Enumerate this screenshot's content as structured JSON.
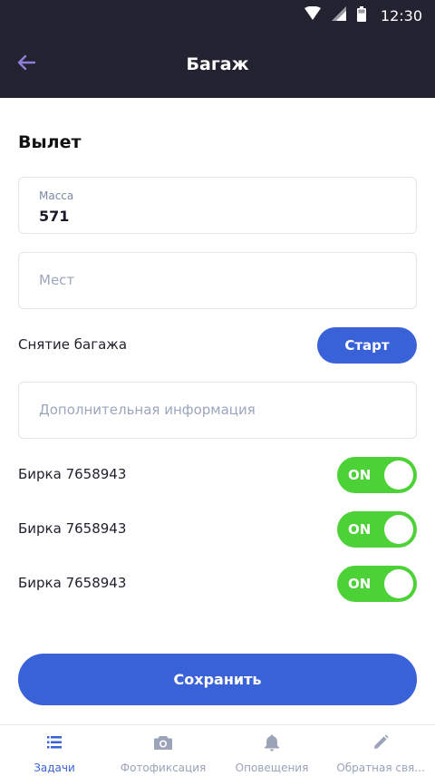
{
  "status_bar": {
    "time": "12:30",
    "icons": [
      "wifi-icon",
      "signal-icon",
      "battery-icon"
    ]
  },
  "app_bar": {
    "title": "Багаж",
    "back_icon": "arrow-left-icon"
  },
  "section": {
    "title": "Вылет"
  },
  "mass_field": {
    "label": "Масса",
    "value": "571"
  },
  "places_field": {
    "placeholder": "Мест"
  },
  "unloading": {
    "label": "Снятие багажа",
    "button_label": "Старт"
  },
  "info_field": {
    "placeholder": "Дополнительная информация"
  },
  "tags": [
    {
      "label": "Бирка 7658943",
      "toggle_label": "ON",
      "on": true
    },
    {
      "label": "Бирка 7658943",
      "toggle_label": "ON",
      "on": true
    },
    {
      "label": "Бирка 7658943",
      "toggle_label": "ON",
      "on": true
    }
  ],
  "save_button": {
    "label": "Сохранить"
  },
  "bottom_nav": {
    "items": [
      {
        "label": "Задачи",
        "icon": "list-icon",
        "active": true
      },
      {
        "label": "Фотофиксация",
        "icon": "camera-icon",
        "active": false
      },
      {
        "label": "Оповещения",
        "icon": "bell-icon",
        "active": false
      },
      {
        "label": "Обратная свя...",
        "icon": "pencil-icon",
        "active": false
      }
    ]
  },
  "colors": {
    "header_bg": "#232230",
    "accent": "#3a62d8",
    "toggle_on": "#4cd137",
    "nav_inactive": "#9aa3b8"
  }
}
